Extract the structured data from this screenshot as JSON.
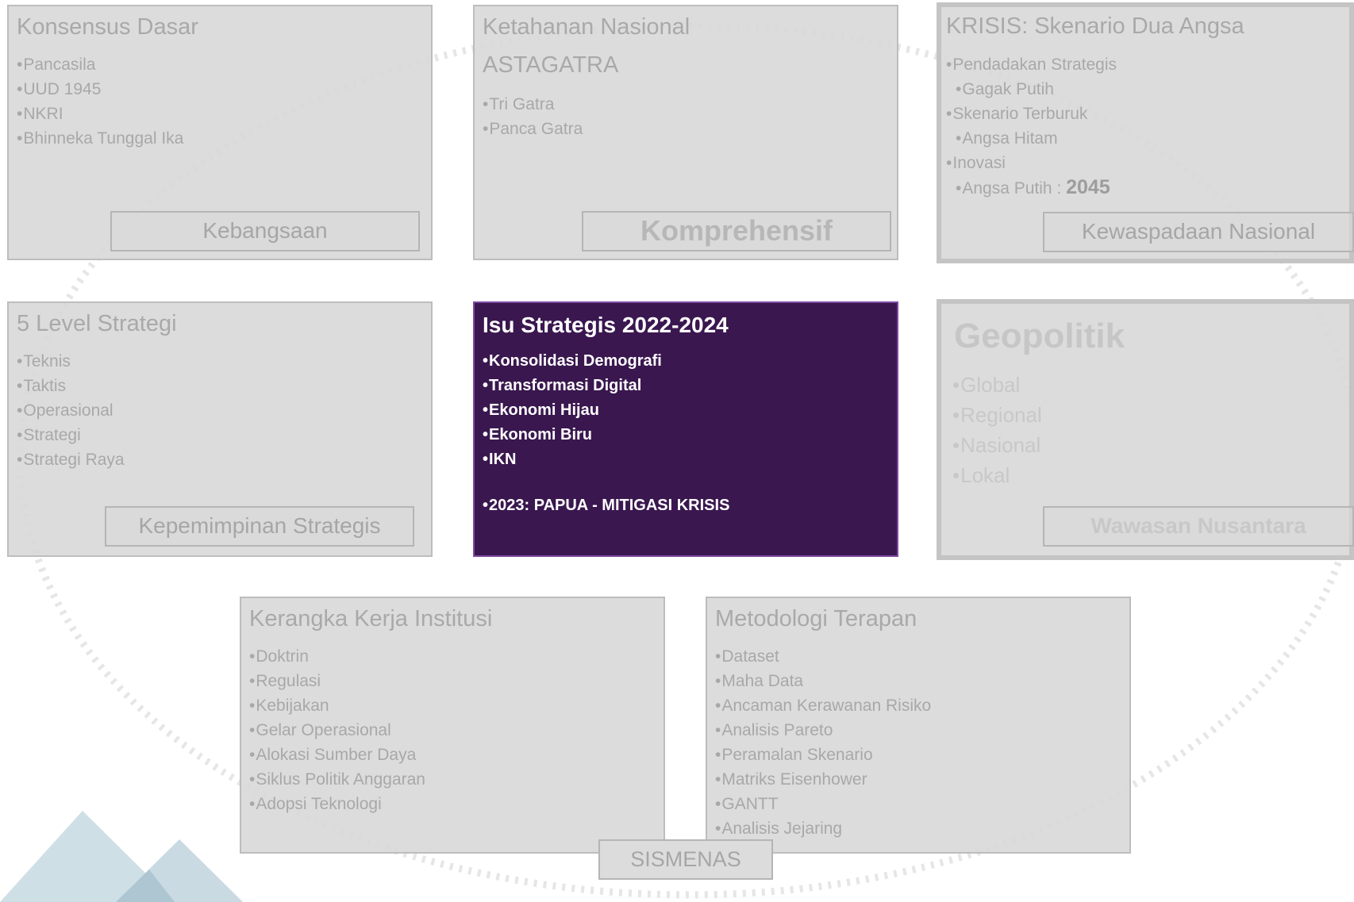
{
  "colors": {
    "panel_gray": "#d9d9d9",
    "panel_border": "#bdbdbd",
    "text_gray": "#a8a8a8",
    "highlight_bg": "#3a174f",
    "highlight_text": "#ffffff",
    "triangle": "#c9d9e0"
  },
  "panels": {
    "konsensus": {
      "title": "Konsensus Dasar",
      "items": [
        "Pancasila",
        "UUD 1945",
        "NKRI",
        "Bhinneka Tunggal Ika"
      ],
      "tag": "Kebangsaan"
    },
    "ketahanan": {
      "title": "Ketahanan Nasional",
      "subtitle": "ASTAGATRA",
      "items": [
        "Tri Gatra",
        "Panca Gatra"
      ],
      "tag": "Komprehensif"
    },
    "krisis": {
      "title": "KRISIS: Skenario Dua Angsa",
      "items": [
        "Pendadakan Strategis",
        "Gagak Putih",
        "Skenario Terburuk",
        "Angsa Hitam",
        "Inovasi"
      ],
      "last_item_prefix": "Angsa Putih : ",
      "last_item_year": "2045",
      "tag": "Kewaspadaan Nasional"
    },
    "level": {
      "title": "5 Level Strategi",
      "items": [
        "Teknis",
        "Taktis",
        "Operasional",
        "Strategi",
        "Strategi Raya"
      ],
      "tag": "Kepemimpinan Strategis"
    },
    "isu": {
      "title": "Isu Strategis 2022-2024",
      "items": [
        "Konsolidasi Demografi",
        "Transformasi Digital",
        "Ekonomi Hijau",
        "Ekonomi Biru",
        "IKN"
      ],
      "extra": "2023: PAPUA - MITIGASI KRISIS"
    },
    "geopolitik": {
      "title": "Geopolitik",
      "items": [
        "Global",
        "Regional",
        "Nasional",
        "Lokal"
      ],
      "tag": "Wawasan Nusantara"
    },
    "kerangka": {
      "title": "Kerangka Kerja Institusi",
      "items": [
        "Doktrin",
        "Regulasi",
        "Kebijakan",
        "Gelar Operasional",
        "Alokasi Sumber Daya",
        "Siklus Politik Anggaran",
        "Adopsi Teknologi"
      ]
    },
    "metodologi": {
      "title": "Metodologi Terapan",
      "items": [
        "Dataset",
        "Maha Data",
        "Ancaman Kerawanan Risiko",
        "Analisis Pareto",
        "Peramalan Skenario",
        "Matriks Eisenhower",
        "GANTT",
        "Analisis Jejaring"
      ]
    }
  },
  "center_tag": "SISMENAS"
}
